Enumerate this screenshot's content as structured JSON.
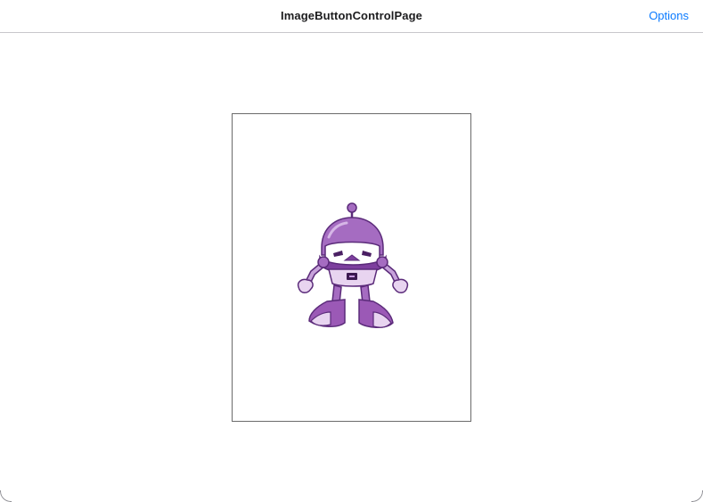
{
  "navbar": {
    "title": "ImageButtonControlPage",
    "options_label": "Options"
  },
  "image_button": {
    "image_icon": "dotnet-bot-icon"
  },
  "colors": {
    "accent": "#0a7aff",
    "bot_purple": "#9b59b6",
    "bot_light": "#e8d4f0",
    "bot_dark": "#5b2b7a"
  }
}
